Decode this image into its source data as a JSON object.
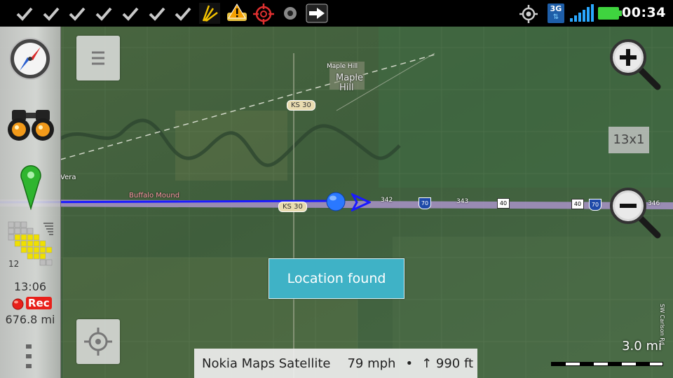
{
  "status_bar": {
    "time": "00:34",
    "network_type": "3G",
    "notification_icons": [
      "check-icon",
      "check-icon",
      "check-icon",
      "check-icon",
      "check-icon",
      "check-icon",
      "check-icon",
      "sprint-icon",
      "warning-car-icon",
      "crosshair-icon",
      "record-icon",
      "arrow-right-icon"
    ]
  },
  "left_panel": {
    "grid_count": "12",
    "time": "13:06",
    "rec_label": "Rec",
    "distance": "676.8 mi"
  },
  "map": {
    "labels": {
      "maple_hill_small": "Maple Hill",
      "maple_hill_line1": "Maple",
      "maple_hill_line2": "Hill",
      "ks30_top": "KS 30",
      "ks30_bottom": "KS 30",
      "vera": "Vera",
      "buffalo_mound": "Buffalo Mound",
      "road_342": "342",
      "road_343": "343",
      "road_345": "346",
      "shield_40a": "40",
      "shield_40b": "40",
      "shield_70": "70",
      "shield_70b": "70",
      "carlson_rd": "SW Carlson Rd"
    },
    "zoom_level_label": "13x1",
    "scale_label": "3.0 mi",
    "toast": "Location found"
  },
  "info_bar": {
    "source": "Nokia Maps Satellite",
    "speed": "79 mph",
    "separator": "•",
    "altitude": "↑ 990 ft"
  },
  "colors": {
    "track": "#1a1aff",
    "toast_bg": "#3fb2c6",
    "battery": "#3fd43f",
    "rec_red": "#e8201a"
  }
}
